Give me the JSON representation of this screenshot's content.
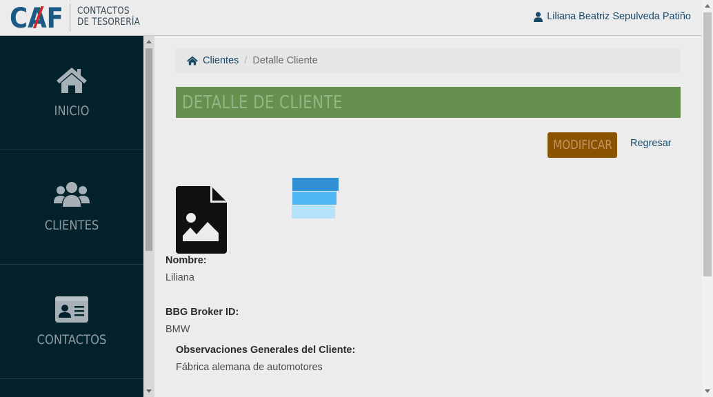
{
  "header": {
    "logo_mark": "CAF",
    "logo_line1": "CONTACTOS",
    "logo_line2": "DE TESORERÍA",
    "user_name": "Liliana Beatriz Sepulveda Patiño"
  },
  "sidebar": {
    "items": [
      {
        "label": "INICIO",
        "icon": "home-icon"
      },
      {
        "label": "CLIENTES",
        "icon": "users-icon"
      },
      {
        "label": "CONTACTOS",
        "icon": "id-card-icon"
      }
    ]
  },
  "breadcrumb": {
    "home_label": "Clientes",
    "separator": "/",
    "current": "Detalle Cliente"
  },
  "page": {
    "title": "DETALLE DE CLIENTE",
    "modify_button": "MODIFICAR",
    "back_link": "Regresar"
  },
  "fields": {
    "nombre_label": "Nombre:",
    "nombre_value": "Liliana",
    "bbg_label": "BBG Broker ID:",
    "bbg_value": "BMW",
    "obs_label": "Observaciones Generales del Cliente:",
    "obs_value": "Fábrica alemana de automotores"
  },
  "colors": {
    "sidebar_bg": "#03222c",
    "title_bar": "#66904e",
    "modify_button": "#8a5300",
    "link": "#1b4a6b",
    "logo_blue": "#1b5a85",
    "logo_red": "#cc2a2a"
  }
}
